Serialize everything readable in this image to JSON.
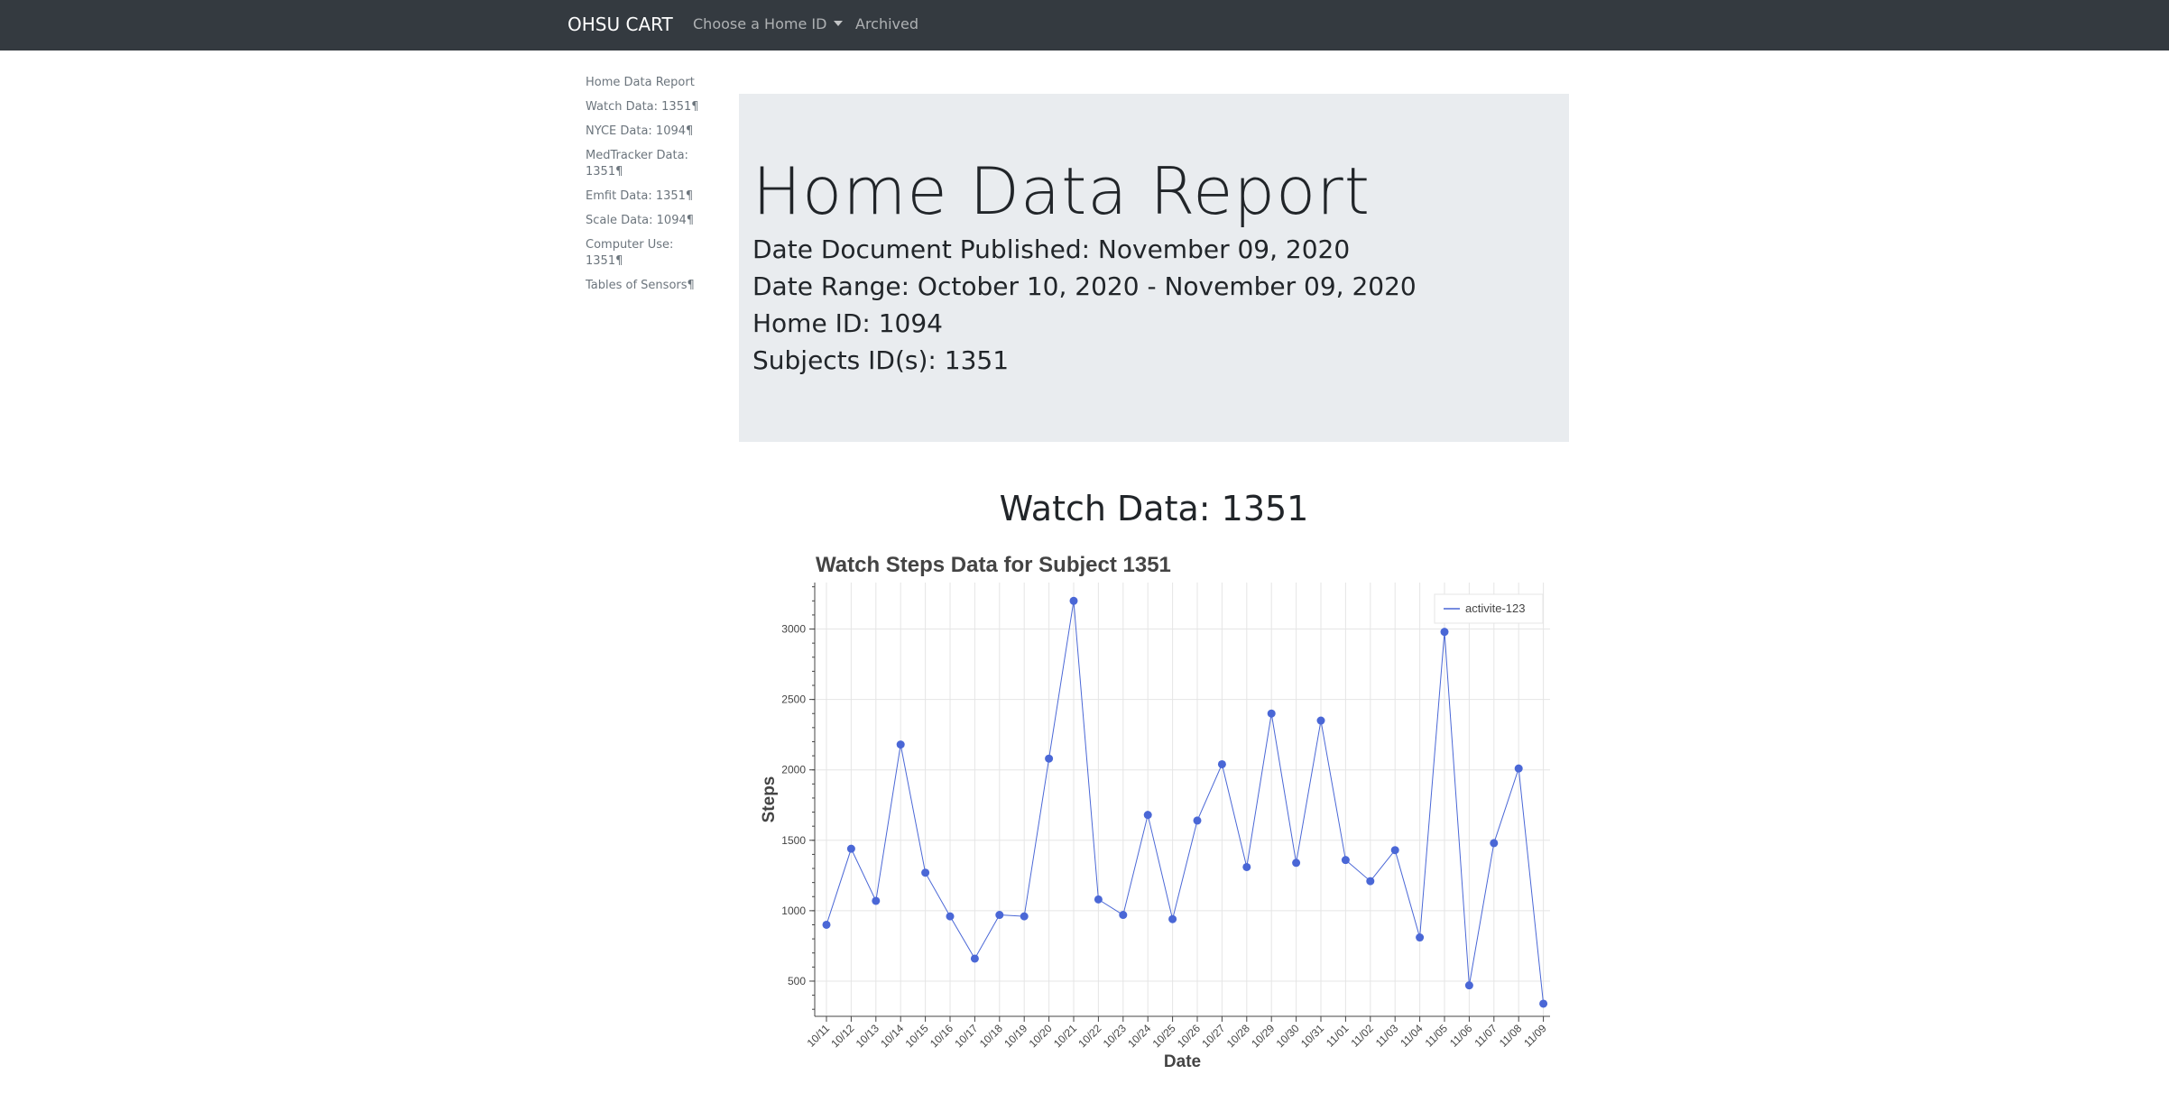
{
  "navbar": {
    "brand": "OHSU CART",
    "dropdown_label": "Choose a Home ID",
    "archived_label": "Archived"
  },
  "sidebar": {
    "items": [
      {
        "label": "Home Data Report"
      },
      {
        "label": "Watch Data: 1351¶"
      },
      {
        "label": "NYCE Data: 1094¶"
      },
      {
        "label": "MedTracker Data: 1351¶"
      },
      {
        "label": "Emfit Data: 1351¶"
      },
      {
        "label": "Scale Data: 1094¶"
      },
      {
        "label": "Computer Use: 1351¶"
      },
      {
        "label": "Tables of Sensors¶"
      }
    ]
  },
  "jumbotron": {
    "title": "Home Data Report",
    "published": "Date Document Published: November 09, 2020",
    "range": "Date Range: October 10, 2020 - November 09, 2020",
    "home_id": "Home ID: 1094",
    "subjects": "Subjects ID(s): 1351"
  },
  "section": {
    "title": "Watch Data: 1351"
  },
  "colors": {
    "navbar_bg": "#343a40",
    "jumbotron_bg": "#e9ecef",
    "series": "#4a67d6"
  },
  "chart_data": {
    "type": "line",
    "title": "Watch Steps Data for Subject 1351",
    "xlabel": "Date",
    "ylabel": "Steps",
    "ylim": [
      250,
      3330
    ],
    "yticks": [
      500,
      1000,
      1500,
      2000,
      2500,
      3000
    ],
    "grid": true,
    "legend_position": "top-right",
    "categories": [
      "10/11",
      "10/12",
      "10/13",
      "10/14",
      "10/15",
      "10/16",
      "10/17",
      "10/18",
      "10/19",
      "10/20",
      "10/21",
      "10/22",
      "10/23",
      "10/24",
      "10/25",
      "10/26",
      "10/27",
      "10/28",
      "10/29",
      "10/30",
      "10/31",
      "11/01",
      "11/02",
      "11/03",
      "11/04",
      "11/05",
      "11/06",
      "11/07",
      "11/08",
      "11/09"
    ],
    "series": [
      {
        "name": "activite-123",
        "values": [
          900,
          1440,
          1070,
          2180,
          1270,
          960,
          660,
          970,
          960,
          2080,
          3200,
          1080,
          970,
          1680,
          940,
          1640,
          2040,
          1310,
          2400,
          1340,
          2350,
          1360,
          1210,
          1430,
          810,
          2980,
          470,
          1480,
          2010,
          340
        ]
      }
    ]
  }
}
